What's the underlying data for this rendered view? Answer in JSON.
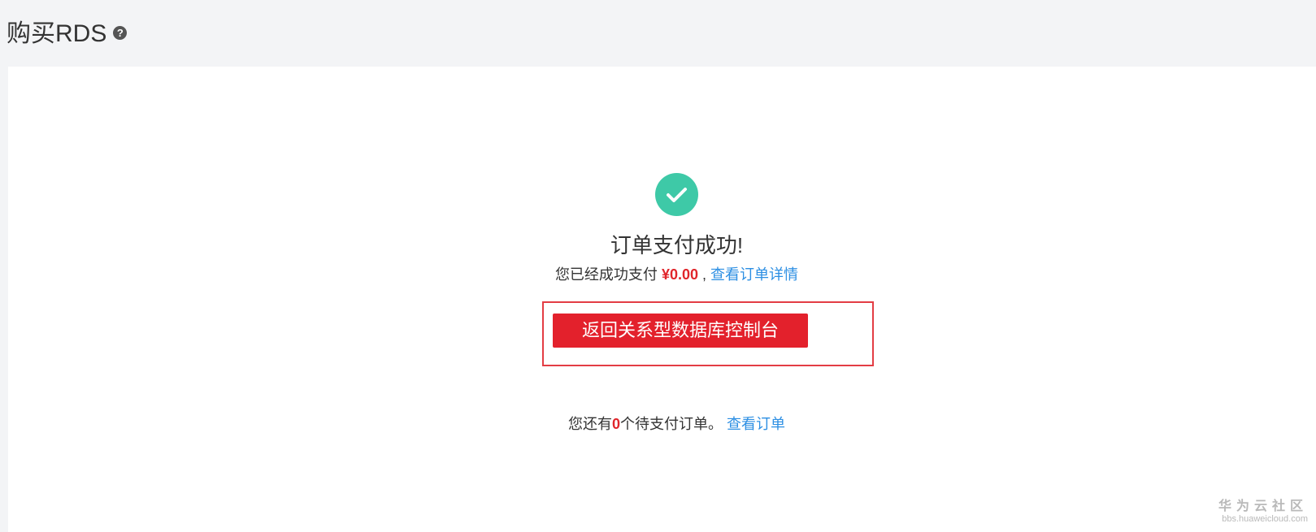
{
  "header": {
    "title": "购买RDS",
    "help_icon": "question-circle-icon",
    "help_glyph": "?"
  },
  "result": {
    "icon": "check-circle-icon",
    "icon_color": "#3ec9a7",
    "title": "订单支付成功!",
    "paid_prefix": "您已经成功支付",
    "paid_amount": "¥0.00",
    "paid_separator": ",",
    "view_order_detail_link": "查看订单详情",
    "return_button_label": "返回关系型数据库控制台",
    "pending_prefix": "您还有",
    "pending_count": "0",
    "pending_suffix": "个待支付订单。",
    "view_orders_link": "查看订单"
  },
  "colors": {
    "accent_red": "#e3212c",
    "link_blue": "#2d8fe3",
    "highlight_border": "#e33d44"
  },
  "watermark": {
    "main": "华为云社区",
    "sub": "bbs.huaweicloud.com"
  }
}
